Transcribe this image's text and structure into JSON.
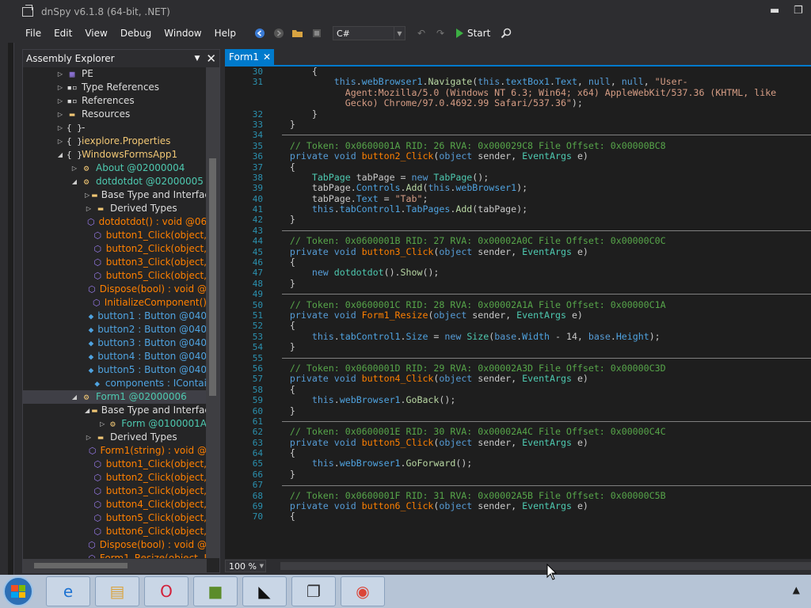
{
  "window": {
    "title": "dnSpy v6.1.8 (64-bit, .NET)",
    "minimize_glyph": "▬",
    "maximize_glyph": "❐"
  },
  "menu": [
    "File",
    "Edit",
    "View",
    "Debug",
    "Window",
    "Help"
  ],
  "toolbar": {
    "language": "C#",
    "start_label": "Start"
  },
  "explorer": {
    "title": "Assembly Explorer",
    "items": [
      {
        "indent": 0,
        "exp": "▷",
        "icon": "▦",
        "cls": "p",
        "label": "PE",
        "lcls": "w"
      },
      {
        "indent": 0,
        "exp": "▷",
        "icon": "▪▫",
        "cls": "w",
        "label": "Type References",
        "lcls": "w"
      },
      {
        "indent": 0,
        "exp": "▷",
        "icon": "▪▫",
        "cls": "w",
        "label": "References",
        "lcls": "w"
      },
      {
        "indent": 0,
        "exp": "▷",
        "icon": "▬",
        "cls": "y",
        "label": "Resources",
        "lcls": "w"
      },
      {
        "indent": 0,
        "exp": "▷",
        "icon": "{ }",
        "cls": "w",
        "label": "-",
        "lcls": "w"
      },
      {
        "indent": 0,
        "exp": "▷",
        "icon": "{ }",
        "cls": "w",
        "label": "iexplore.Properties",
        "lcls": "y"
      },
      {
        "indent": 0,
        "exp": "◢",
        "icon": "{ }",
        "cls": "w",
        "label": "WindowsFormsApp1",
        "lcls": "y"
      },
      {
        "indent": 1,
        "exp": "▷",
        "icon": "⚙",
        "cls": "y",
        "label": "About @02000004",
        "lcls": "t"
      },
      {
        "indent": 1,
        "exp": "◢",
        "icon": "⚙",
        "cls": "y",
        "label": "dotdotdot @02000005",
        "lcls": "t"
      },
      {
        "indent": 2,
        "exp": "▷",
        "icon": "▬",
        "cls": "y",
        "label": "Base Type and Interfac",
        "lcls": "w"
      },
      {
        "indent": 2,
        "exp": "▷",
        "icon": "▬",
        "cls": "y",
        "label": "Derived Types",
        "lcls": "w"
      },
      {
        "indent": 2,
        "exp": "",
        "icon": "⬡",
        "cls": "p",
        "label": "dotdotdot() : void @06",
        "lcls": "m"
      },
      {
        "indent": 2,
        "exp": "",
        "icon": "⬡",
        "cls": "p",
        "label": "button1_Click(object,",
        "lcls": "m"
      },
      {
        "indent": 2,
        "exp": "",
        "icon": "⬡",
        "cls": "p",
        "label": "button2_Click(object,",
        "lcls": "m"
      },
      {
        "indent": 2,
        "exp": "",
        "icon": "⬡",
        "cls": "p",
        "label": "button3_Click(object,",
        "lcls": "m"
      },
      {
        "indent": 2,
        "exp": "",
        "icon": "⬡",
        "cls": "p",
        "label": "button5_Click(object,",
        "lcls": "m"
      },
      {
        "indent": 2,
        "exp": "",
        "icon": "⬡",
        "cls": "p",
        "label": "Dispose(bool) : void @",
        "lcls": "m"
      },
      {
        "indent": 2,
        "exp": "",
        "icon": "⬡",
        "cls": "p",
        "label": "InitializeComponent()",
        "lcls": "m"
      },
      {
        "indent": 2,
        "exp": "",
        "icon": "◆",
        "cls": "f",
        "label": "button1 : Button @040",
        "lcls": "f"
      },
      {
        "indent": 2,
        "exp": "",
        "icon": "◆",
        "cls": "f",
        "label": "button2 : Button @040",
        "lcls": "f"
      },
      {
        "indent": 2,
        "exp": "",
        "icon": "◆",
        "cls": "f",
        "label": "button3 : Button @040",
        "lcls": "f"
      },
      {
        "indent": 2,
        "exp": "",
        "icon": "◆",
        "cls": "f",
        "label": "button4 : Button @040",
        "lcls": "f"
      },
      {
        "indent": 2,
        "exp": "",
        "icon": "◆",
        "cls": "f",
        "label": "button5 : Button @040",
        "lcls": "f"
      },
      {
        "indent": 2,
        "exp": "",
        "icon": "◆",
        "cls": "f",
        "label": "components : IContai",
        "lcls": "f"
      },
      {
        "indent": 1,
        "exp": "◢",
        "icon": "⚙",
        "cls": "y",
        "label": "Form1 @02000006",
        "lcls": "t",
        "selected": true
      },
      {
        "indent": 2,
        "exp": "◢",
        "icon": "▬",
        "cls": "y",
        "label": "Base Type and Interfac",
        "lcls": "w"
      },
      {
        "indent": 3,
        "exp": "▷",
        "icon": "⚙",
        "cls": "y",
        "label": "Form @0100001A",
        "lcls": "t"
      },
      {
        "indent": 2,
        "exp": "▷",
        "icon": "▬",
        "cls": "y",
        "label": "Derived Types",
        "lcls": "w"
      },
      {
        "indent": 2,
        "exp": "",
        "icon": "⬡",
        "cls": "p",
        "label": "Form1(string) : void @",
        "lcls": "m"
      },
      {
        "indent": 2,
        "exp": "",
        "icon": "⬡",
        "cls": "p",
        "label": "button1_Click(object,",
        "lcls": "m"
      },
      {
        "indent": 2,
        "exp": "",
        "icon": "⬡",
        "cls": "p",
        "label": "button2_Click(object,",
        "lcls": "m"
      },
      {
        "indent": 2,
        "exp": "",
        "icon": "⬡",
        "cls": "p",
        "label": "button3_Click(object,",
        "lcls": "m"
      },
      {
        "indent": 2,
        "exp": "",
        "icon": "⬡",
        "cls": "p",
        "label": "button4_Click(object,",
        "lcls": "m"
      },
      {
        "indent": 2,
        "exp": "",
        "icon": "⬡",
        "cls": "p",
        "label": "button5_Click(object,",
        "lcls": "m"
      },
      {
        "indent": 2,
        "exp": "",
        "icon": "⬡",
        "cls": "p",
        "label": "button6_Click(object,",
        "lcls": "m"
      },
      {
        "indent": 2,
        "exp": "",
        "icon": "⬡",
        "cls": "p",
        "label": "Dispose(bool) : void @",
        "lcls": "m"
      },
      {
        "indent": 2,
        "exp": "",
        "icon": "⬡",
        "cls": "p",
        "label": "Form1_Resize(object, I",
        "lcls": "m"
      }
    ]
  },
  "editor": {
    "tab": "Form1",
    "zoom": "100 %",
    "line_numbers": [
      "30",
      "31",
      "",
      "",
      "32",
      "33",
      "34",
      "35",
      "36",
      "37",
      "38",
      "39",
      "40",
      "41",
      "42",
      "43",
      "44",
      "45",
      "46",
      "47",
      "48",
      "49",
      "50",
      "51",
      "52",
      "53",
      "54",
      "55",
      "56",
      "57",
      "58",
      "59",
      "60",
      "61",
      "62",
      "63",
      "64",
      "65",
      "66",
      "67",
      "68",
      "69",
      "70"
    ],
    "lines": [
      [
        [
          "pr",
          "        {"
        ]
      ],
      [
        [
          "pr",
          "            "
        ],
        [
          "kw",
          "this"
        ],
        [
          "pr",
          "."
        ],
        [
          "fi",
          "webBrowser1"
        ],
        [
          "pr",
          "."
        ],
        [
          "mt",
          "Navigate"
        ],
        [
          "pr",
          "("
        ],
        [
          "kw",
          "this"
        ],
        [
          "pr",
          "."
        ],
        [
          "fi",
          "textBox1"
        ],
        [
          "pr",
          "."
        ],
        [
          "fi",
          "Text"
        ],
        [
          "pr",
          ", "
        ],
        [
          "kw",
          "null"
        ],
        [
          "pr",
          ", "
        ],
        [
          "kw",
          "null"
        ],
        [
          "pr",
          ", "
        ],
        [
          "st",
          "\"User-"
        ]
      ],
      [
        [
          "st",
          "              Agent:Mozilla/5.0 (Windows NT 6.3; Win64; x64) AppleWebKit/537.36 (KHTML, like"
        ]
      ],
      [
        [
          "st",
          "              Gecko) Chrome/97.0.4692.99 Safari/537.36\""
        ],
        [
          "pr",
          ");"
        ]
      ],
      [
        [
          "pr",
          "        }"
        ]
      ],
      [
        [
          "pr",
          "    }"
        ]
      ],
      [
        [
          "pr",
          ""
        ]
      ],
      [
        [
          "cm",
          "    // Token: 0x0600001A RID: 26 RVA: 0x000029C8 File Offset: 0x00000BC8"
        ]
      ],
      [
        [
          "pr",
          "    "
        ],
        [
          "kw",
          "private void "
        ],
        [
          "me",
          "button2_Click"
        ],
        [
          "pr",
          "("
        ],
        [
          "kw",
          "object "
        ],
        [
          "pr",
          "sender, "
        ],
        [
          "ty",
          "EventArgs "
        ],
        [
          "pr",
          "e)"
        ]
      ],
      [
        [
          "pr",
          "    {"
        ]
      ],
      [
        [
          "pr",
          "        "
        ],
        [
          "ty",
          "TabPage "
        ],
        [
          "pr",
          "tabPage = "
        ],
        [
          "kw",
          "new "
        ],
        [
          "ty",
          "TabPage"
        ],
        [
          "pr",
          "();"
        ]
      ],
      [
        [
          "pr",
          "        tabPage."
        ],
        [
          "fi",
          "Controls"
        ],
        [
          "pr",
          "."
        ],
        [
          "mt",
          "Add"
        ],
        [
          "pr",
          "("
        ],
        [
          "kw",
          "this"
        ],
        [
          "pr",
          "."
        ],
        [
          "fi",
          "webBrowser1"
        ],
        [
          "pr",
          ");"
        ]
      ],
      [
        [
          "pr",
          "        tabPage."
        ],
        [
          "fi",
          "Text"
        ],
        [
          "pr",
          " = "
        ],
        [
          "st",
          "\"Tab\""
        ],
        [
          "pr",
          ";"
        ]
      ],
      [
        [
          "pr",
          "        "
        ],
        [
          "kw",
          "this"
        ],
        [
          "pr",
          "."
        ],
        [
          "fi",
          "tabControl1"
        ],
        [
          "pr",
          "."
        ],
        [
          "fi",
          "TabPages"
        ],
        [
          "pr",
          "."
        ],
        [
          "mt",
          "Add"
        ],
        [
          "pr",
          "(tabPage);"
        ]
      ],
      [
        [
          "pr",
          "    }"
        ]
      ],
      [
        [
          "pr",
          ""
        ]
      ],
      [
        [
          "cm",
          "    // Token: 0x0600001B RID: 27 RVA: 0x00002A0C File Offset: 0x00000C0C"
        ]
      ],
      [
        [
          "pr",
          "    "
        ],
        [
          "kw",
          "private void "
        ],
        [
          "me",
          "button3_Click"
        ],
        [
          "pr",
          "("
        ],
        [
          "kw",
          "object "
        ],
        [
          "pr",
          "sender, "
        ],
        [
          "ty",
          "EventArgs "
        ],
        [
          "pr",
          "e)"
        ]
      ],
      [
        [
          "pr",
          "    {"
        ]
      ],
      [
        [
          "pr",
          "        "
        ],
        [
          "kw",
          "new "
        ],
        [
          "ty",
          "dotdotdot"
        ],
        [
          "pr",
          "()."
        ],
        [
          "mt",
          "Show"
        ],
        [
          "pr",
          "();"
        ]
      ],
      [
        [
          "pr",
          "    }"
        ]
      ],
      [
        [
          "pr",
          ""
        ]
      ],
      [
        [
          "cm",
          "    // Token: 0x0600001C RID: 28 RVA: 0x00002A1A File Offset: 0x00000C1A"
        ]
      ],
      [
        [
          "pr",
          "    "
        ],
        [
          "kw",
          "private void "
        ],
        [
          "me",
          "Form1_Resize"
        ],
        [
          "pr",
          "("
        ],
        [
          "kw",
          "object "
        ],
        [
          "pr",
          "sender, "
        ],
        [
          "ty",
          "EventArgs "
        ],
        [
          "pr",
          "e)"
        ]
      ],
      [
        [
          "pr",
          "    {"
        ]
      ],
      [
        [
          "pr",
          "        "
        ],
        [
          "kw",
          "this"
        ],
        [
          "pr",
          "."
        ],
        [
          "fi",
          "tabControl1"
        ],
        [
          "pr",
          "."
        ],
        [
          "fi",
          "Size"
        ],
        [
          "pr",
          " = "
        ],
        [
          "kw",
          "new "
        ],
        [
          "ty",
          "Size"
        ],
        [
          "pr",
          "("
        ],
        [
          "kw",
          "base"
        ],
        [
          "pr",
          "."
        ],
        [
          "fi",
          "Width"
        ],
        [
          "pr",
          " - 14, "
        ],
        [
          "kw",
          "base"
        ],
        [
          "pr",
          "."
        ],
        [
          "fi",
          "Height"
        ],
        [
          "pr",
          ");"
        ]
      ],
      [
        [
          "pr",
          "    }"
        ]
      ],
      [
        [
          "pr",
          ""
        ]
      ],
      [
        [
          "cm",
          "    // Token: 0x0600001D RID: 29 RVA: 0x00002A3D File Offset: 0x00000C3D"
        ]
      ],
      [
        [
          "pr",
          "    "
        ],
        [
          "kw",
          "private void "
        ],
        [
          "me",
          "button4_Click"
        ],
        [
          "pr",
          "("
        ],
        [
          "kw",
          "object "
        ],
        [
          "pr",
          "sender, "
        ],
        [
          "ty",
          "EventArgs "
        ],
        [
          "pr",
          "e)"
        ]
      ],
      [
        [
          "pr",
          "    {"
        ]
      ],
      [
        [
          "pr",
          "        "
        ],
        [
          "kw",
          "this"
        ],
        [
          "pr",
          "."
        ],
        [
          "fi",
          "webBrowser1"
        ],
        [
          "pr",
          "."
        ],
        [
          "mt",
          "GoBack"
        ],
        [
          "pr",
          "();"
        ]
      ],
      [
        [
          "pr",
          "    }"
        ]
      ],
      [
        [
          "pr",
          ""
        ]
      ],
      [
        [
          "cm",
          "    // Token: 0x0600001E RID: 30 RVA: 0x00002A4C File Offset: 0x00000C4C"
        ]
      ],
      [
        [
          "pr",
          "    "
        ],
        [
          "kw",
          "private void "
        ],
        [
          "me",
          "button5_Click"
        ],
        [
          "pr",
          "("
        ],
        [
          "kw",
          "object "
        ],
        [
          "pr",
          "sender, "
        ],
        [
          "ty",
          "EventArgs "
        ],
        [
          "pr",
          "e)"
        ]
      ],
      [
        [
          "pr",
          "    {"
        ]
      ],
      [
        [
          "pr",
          "        "
        ],
        [
          "kw",
          "this"
        ],
        [
          "pr",
          "."
        ],
        [
          "fi",
          "webBrowser1"
        ],
        [
          "pr",
          "."
        ],
        [
          "mt",
          "GoForward"
        ],
        [
          "pr",
          "();"
        ]
      ],
      [
        [
          "pr",
          "    }"
        ]
      ],
      [
        [
          "pr",
          ""
        ]
      ],
      [
        [
          "cm",
          "    // Token: 0x0600001F RID: 31 RVA: 0x00002A5B File Offset: 0x00000C5B"
        ]
      ],
      [
        [
          "pr",
          "    "
        ],
        [
          "kw",
          "private void "
        ],
        [
          "me",
          "button6_Click"
        ],
        [
          "pr",
          "("
        ],
        [
          "kw",
          "object "
        ],
        [
          "pr",
          "sender, "
        ],
        [
          "ty",
          "EventArgs "
        ],
        [
          "pr",
          "e)"
        ]
      ],
      [
        [
          "pr",
          "    {"
        ]
      ]
    ],
    "separator_after_lines": [
      6,
      15,
      21,
      27,
      33,
      39
    ]
  },
  "taskbar": {
    "apps": [
      {
        "name": "taskbar-ie",
        "glyph": "e",
        "color": "#1e73d2"
      },
      {
        "name": "taskbar-explorer",
        "glyph": "▤",
        "color": "#d9a441"
      },
      {
        "name": "taskbar-opera",
        "glyph": "O",
        "color": "#d3213a"
      },
      {
        "name": "taskbar-minecraft",
        "glyph": "■",
        "color": "#5b8c2a"
      },
      {
        "name": "taskbar-amd",
        "glyph": "◣",
        "color": "#111111"
      },
      {
        "name": "taskbar-dnspy",
        "glyph": "❐",
        "color": "#2d2d30"
      },
      {
        "name": "taskbar-chrome",
        "glyph": "◉",
        "color": "#db4437"
      }
    ],
    "tray_arrow": "▲"
  }
}
